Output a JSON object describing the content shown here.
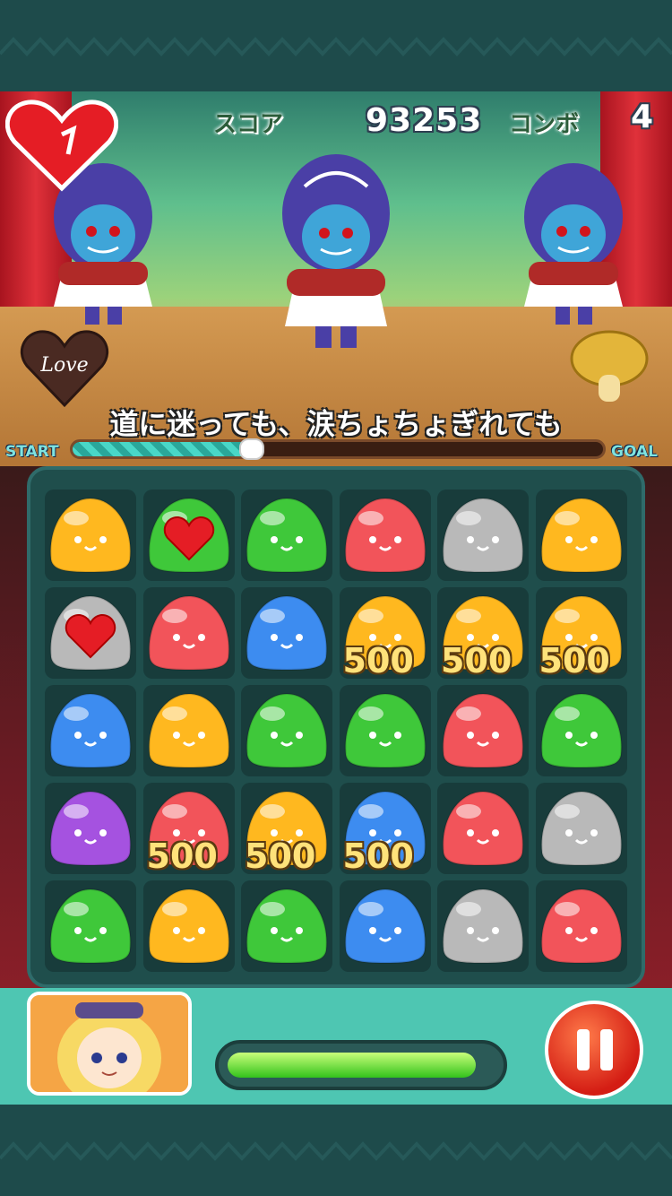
{
  "hud": {
    "score_label": "スコア",
    "score": "93253",
    "combo_label": "コンボ",
    "combo": "4"
  },
  "lyric": "道に迷っても、涙ちょちょぎれても",
  "progress": {
    "start_label": "START",
    "goal_label": "GOAL",
    "fraction": 0.34
  },
  "badges": {
    "love_label": "Love"
  },
  "board": {
    "rows": [
      [
        "yellow",
        "green-heart",
        "green",
        "red",
        "gray",
        "yellow"
      ],
      [
        "gray-heart",
        "red",
        "blue",
        "yellow",
        "yellow",
        "yellow"
      ],
      [
        "blue",
        "yellow",
        "green",
        "green",
        "red",
        "green"
      ],
      [
        "purple",
        "red",
        "yellow",
        "blue",
        "red",
        "gray"
      ],
      [
        "green",
        "yellow",
        "green",
        "blue",
        "gray",
        "red"
      ]
    ],
    "score_pops": [
      {
        "row": 1,
        "col": 3,
        "text": "500"
      },
      {
        "row": 1,
        "col": 4,
        "text": "500"
      },
      {
        "row": 1,
        "col": 5,
        "text": "500"
      },
      {
        "row": 3,
        "col": 1,
        "text": "500"
      },
      {
        "row": 3,
        "col": 2,
        "text": "500"
      },
      {
        "row": 3,
        "col": 3,
        "text": "500"
      }
    ]
  },
  "energy": {
    "fraction": 0.93
  },
  "colors": {
    "yellow": "#ffb81f",
    "green": "#3fc83a",
    "red": "#f2545a",
    "gray": "#b9b9b9",
    "blue": "#3d8cf0",
    "purple": "#a552e0"
  }
}
